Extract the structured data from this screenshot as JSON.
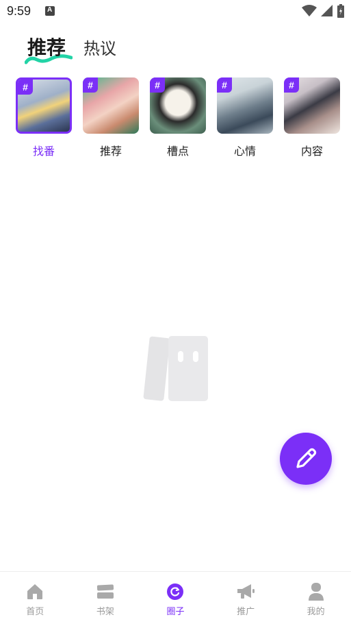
{
  "status_bar": {
    "time": "9:59"
  },
  "top_tabs": [
    {
      "label": "推荐",
      "active": true
    },
    {
      "label": "热议",
      "active": false
    }
  ],
  "topics": [
    {
      "label": "找番",
      "selected": true,
      "hash": "#"
    },
    {
      "label": "推荐",
      "selected": false,
      "hash": "#"
    },
    {
      "label": "槽点",
      "selected": false,
      "hash": "#"
    },
    {
      "label": "心情",
      "selected": false,
      "hash": "#"
    },
    {
      "label": "内容",
      "selected": false,
      "hash": "#"
    }
  ],
  "bottom_nav": [
    {
      "label": "首页",
      "icon": "home-icon",
      "active": false
    },
    {
      "label": "书架",
      "icon": "bookshelf-icon",
      "active": false
    },
    {
      "label": "圈子",
      "icon": "circle-icon",
      "active": true
    },
    {
      "label": "推广",
      "icon": "megaphone-icon",
      "active": false
    },
    {
      "label": "我的",
      "icon": "user-icon",
      "active": false
    }
  ],
  "colors": {
    "accent": "#7b2ff7",
    "inactive": "#9a9a9a",
    "tab_underline": "#22d3a6"
  }
}
